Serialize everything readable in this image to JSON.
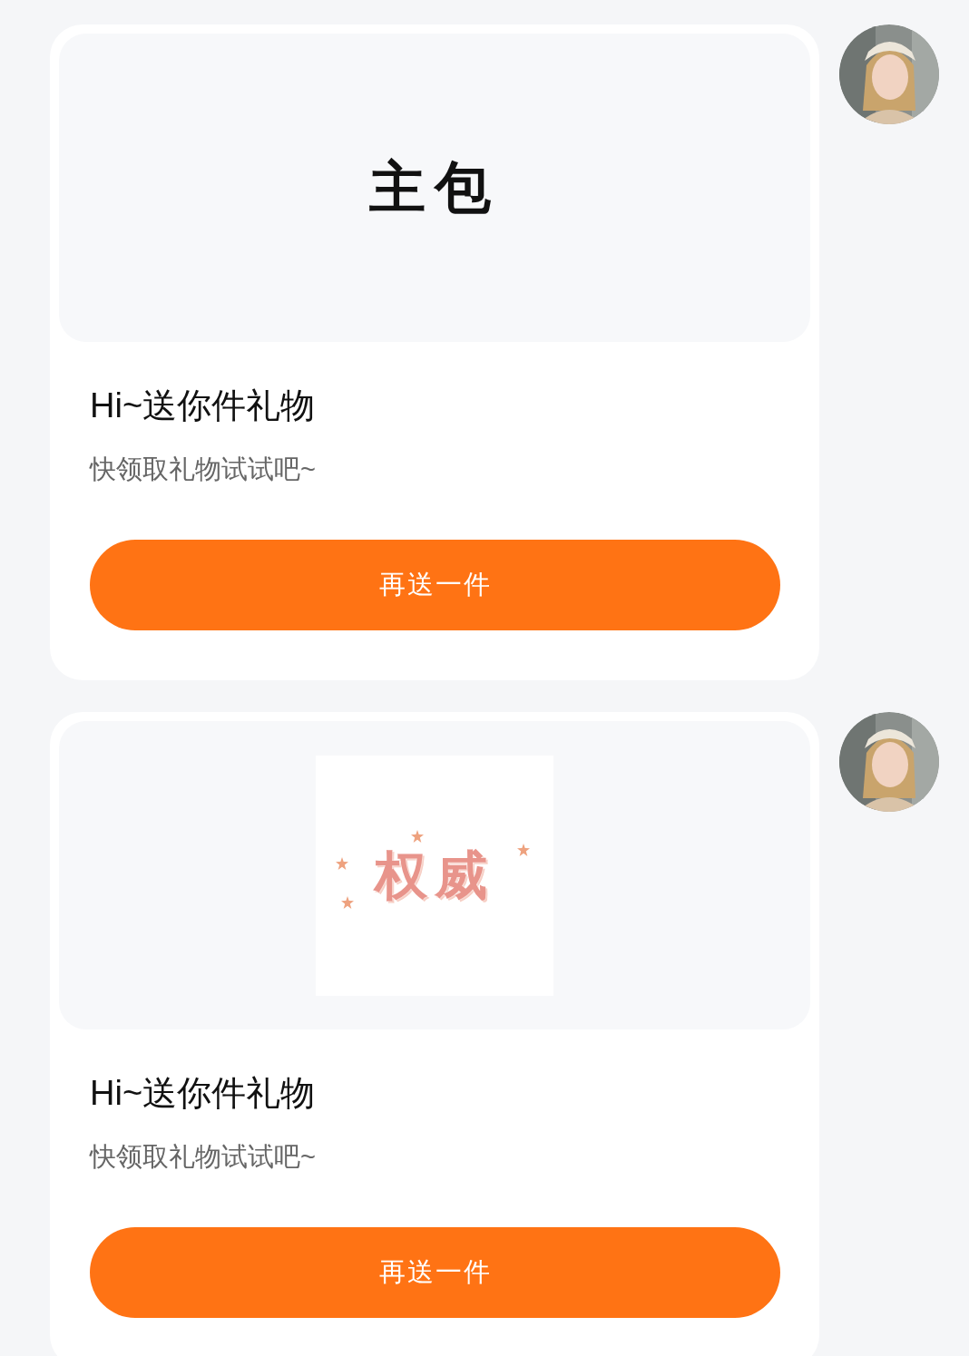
{
  "messages": [
    {
      "gift": {
        "kind": "plain",
        "name": "主包"
      },
      "title": "Hi~送你件礼物",
      "subtitle": "快领取礼物试试吧~",
      "button": "再送一件"
    },
    {
      "gift": {
        "kind": "sticker",
        "name": "权威"
      },
      "title": "Hi~送你件礼物",
      "subtitle": "快领取礼物试试吧~",
      "button": "再送一件"
    }
  ]
}
